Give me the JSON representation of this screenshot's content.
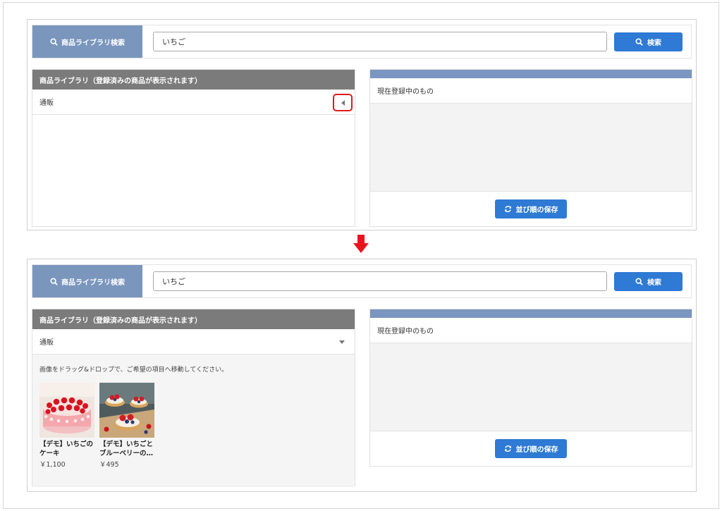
{
  "before": {
    "search": {
      "label": "商品ライブラリ検索",
      "query": "いちご",
      "button": "検索"
    },
    "library": {
      "heading": "商品ライブラリ（登録済みの商品が表示されます）",
      "category": "通販"
    },
    "registered": {
      "title": "現在登録中のもの",
      "save_button": "並び順の保存"
    }
  },
  "after": {
    "search": {
      "label": "商品ライブラリ検索",
      "query": "いちご",
      "button": "検索"
    },
    "library": {
      "heading": "商品ライブラリ（登録済みの商品が表示されます）",
      "category": "通販",
      "hint": "画像をドラッグ&ドロップで、ご希望の項目へ移動してください。",
      "products": [
        {
          "name": "【デモ】いちごのケーキ",
          "price": "￥1,100"
        },
        {
          "name": "【デモ】いちごとブルーベリーの…",
          "price": "￥495"
        }
      ]
    },
    "registered": {
      "title": "現在登録中のもの",
      "save_button": "並び順の保存"
    }
  },
  "icons": {
    "search": "search-icon",
    "refresh": "refresh-icon",
    "collapse": "caret-left-icon",
    "expand": "caret-down-icon",
    "step": "down-arrow-icon"
  },
  "colors": {
    "search_label_bg": "#7a96bd",
    "button_blue": "#2e7ad4",
    "library_header": "#7b7b7b",
    "registered_bar": "#7b96c0",
    "highlight_red": "#e11a1a"
  }
}
